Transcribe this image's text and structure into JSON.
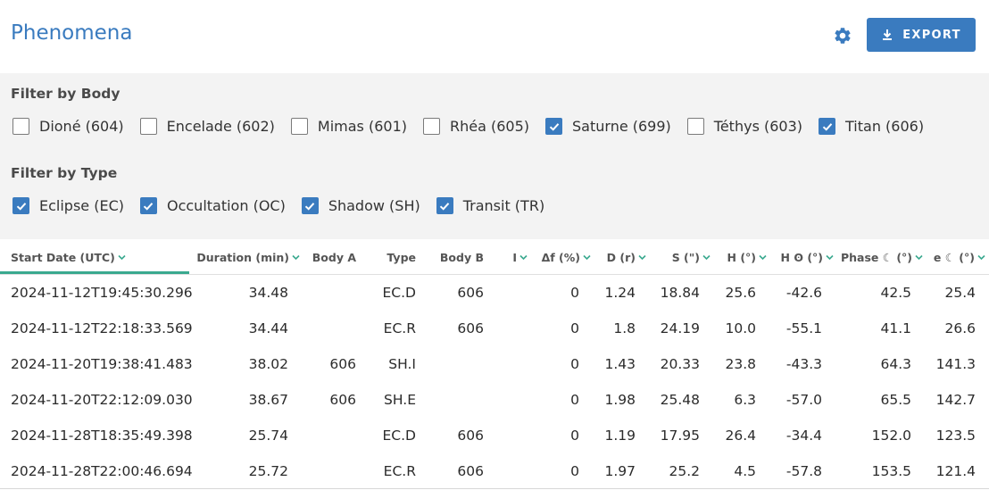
{
  "header": {
    "title": "Phenomena",
    "export_label": "EXPORT",
    "accent": "#3a7bbf"
  },
  "filters": {
    "body_title": "Filter by Body",
    "bodies": [
      {
        "label": "Dioné (604)",
        "checked": false
      },
      {
        "label": "Encelade (602)",
        "checked": false
      },
      {
        "label": "Mimas (601)",
        "checked": false
      },
      {
        "label": "Rhéa (605)",
        "checked": false
      },
      {
        "label": "Saturne (699)",
        "checked": true
      },
      {
        "label": "Téthys (603)",
        "checked": false
      },
      {
        "label": "Titan (606)",
        "checked": true
      }
    ],
    "type_title": "Filter by Type",
    "types": [
      {
        "label": "Eclipse (EC)",
        "checked": true
      },
      {
        "label": "Occultation (OC)",
        "checked": true
      },
      {
        "label": "Shadow (SH)",
        "checked": true
      },
      {
        "label": "Transit (TR)",
        "checked": true
      }
    ]
  },
  "table": {
    "columns": [
      "Start Date (UTC)",
      "Duration (min)",
      "Body A",
      "Type",
      "Body B",
      "I",
      "Δf (%)",
      "D (r)",
      "S (\")",
      "H (°)",
      "H ʘ (°)",
      "Phase ☾ (°)",
      "e ☾ (°)"
    ],
    "rows": [
      [
        "2024-11-12T19:45:30.296",
        "34.48",
        "",
        "EC.D",
        "606",
        "",
        "0",
        "1.24",
        "18.84",
        "25.6",
        "-42.6",
        "42.5",
        "25.4"
      ],
      [
        "2024-11-12T22:18:33.569",
        "34.44",
        "",
        "EC.R",
        "606",
        "",
        "0",
        "1.8",
        "24.19",
        "10.0",
        "-55.1",
        "41.1",
        "26.6"
      ],
      [
        "2024-11-20T19:38:41.483",
        "38.02",
        "606",
        "SH.I",
        "",
        "",
        "0",
        "1.43",
        "20.33",
        "23.8",
        "-43.3",
        "64.3",
        "141.3"
      ],
      [
        "2024-11-20T22:12:09.030",
        "38.67",
        "606",
        "SH.E",
        "",
        "",
        "0",
        "1.98",
        "25.48",
        "6.3",
        "-57.0",
        "65.5",
        "142.7"
      ],
      [
        "2024-11-28T18:35:49.398",
        "25.74",
        "",
        "EC.D",
        "606",
        "",
        "0",
        "1.19",
        "17.95",
        "26.4",
        "-34.4",
        "152.0",
        "123.5"
      ],
      [
        "2024-11-28T22:00:46.694",
        "25.72",
        "",
        "EC.R",
        "606",
        "",
        "0",
        "1.97",
        "25.2",
        "4.5",
        "-57.8",
        "153.5",
        "121.4"
      ]
    ]
  }
}
